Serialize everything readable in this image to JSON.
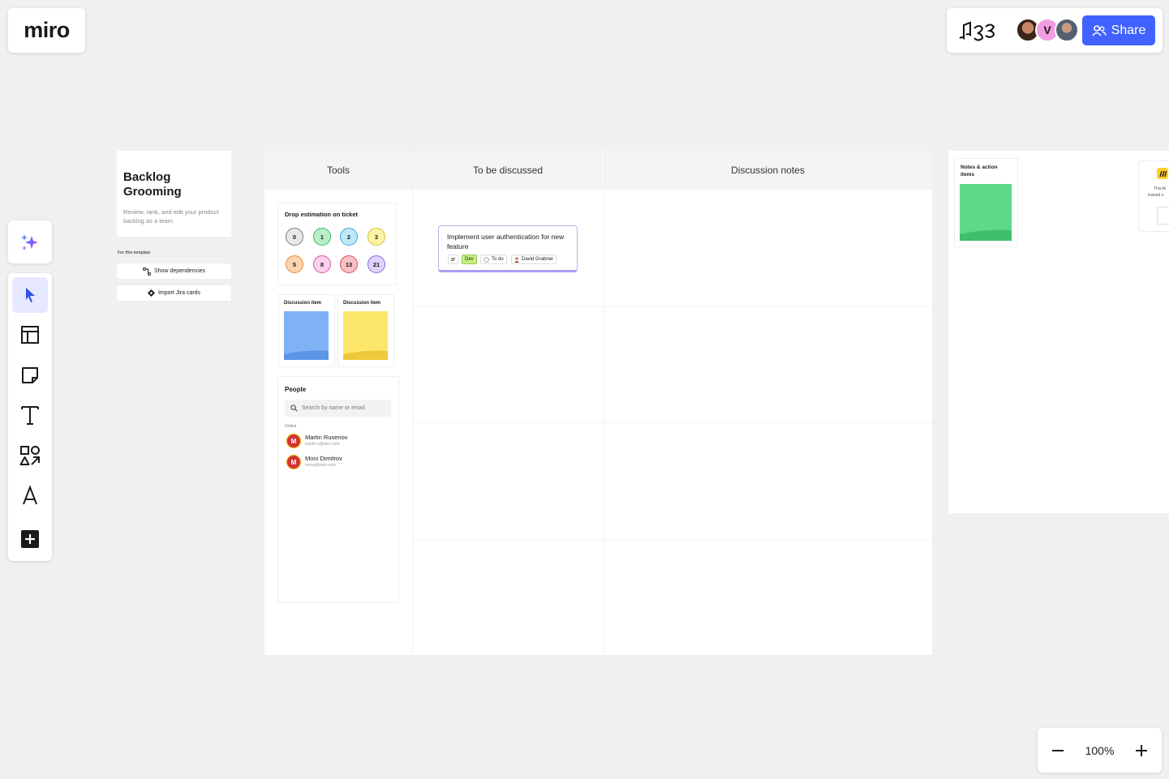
{
  "app": {
    "logo_text": "miro"
  },
  "topbar": {
    "brand_icon": "music-notes-icon",
    "avatars": [
      {
        "name": "avatar-photo-1",
        "label": ""
      },
      {
        "name": "avatar-v",
        "label": "V",
        "color": "#f29ce1"
      },
      {
        "name": "avatar-photo-2",
        "label": ""
      }
    ],
    "share_label": "Share"
  },
  "toolbar": {
    "ai_icon": "sparkles-icon",
    "tools": [
      "select-tool",
      "templates-tool",
      "sticky-note-tool",
      "text-tool",
      "shapes-tool",
      "pen-tool",
      "add-more-tool"
    ]
  },
  "zoom": {
    "level": "100%",
    "minus": "−",
    "plus": "+"
  },
  "intro": {
    "title": "Backlog Grooming",
    "description": "Review, rank, and edit your product backlog as a team.",
    "for_template_label": "For this template",
    "show_dependencies": "Show dependencies",
    "import_jira": "Import Jira cards"
  },
  "board": {
    "columns": [
      "Tools",
      "To be discussed",
      "Discussion notes"
    ]
  },
  "estimation": {
    "title": "Drop estimation on ticket",
    "values": [
      {
        "label": "0",
        "fill": "#e8e8e8",
        "border": "#7a7a7a"
      },
      {
        "label": "1",
        "fill": "#b8efc9",
        "border": "#35b86b"
      },
      {
        "label": "2",
        "fill": "#bfe8f8",
        "border": "#3aa7d8"
      },
      {
        "label": "3",
        "fill": "#fbf3a6",
        "border": "#d8c12e"
      },
      {
        "label": "5",
        "fill": "#fcd3b0",
        "border": "#e88c3c"
      },
      {
        "label": "8",
        "fill": "#fbd0ec",
        "border": "#d256a8"
      },
      {
        "label": "13",
        "fill": "#f7c1c4",
        "border": "#d94b55"
      },
      {
        "label": "21",
        "fill": "#ddd4fb",
        "border": "#8a6ee3"
      }
    ]
  },
  "discussion_items": [
    {
      "title": "Discussion item",
      "color": "#7fb2f5"
    },
    {
      "title": "Discussion item",
      "color": "#fde76a"
    }
  ],
  "people": {
    "title": "People",
    "search_placeholder": "Search by name or email",
    "online_label": "Online",
    "list": [
      {
        "initial": "M",
        "name": "Martin Rusenov",
        "email": "martin.r@miro.com"
      },
      {
        "initial": "M",
        "name": "Moni Dimitrov",
        "email": "mony@miro.com"
      }
    ]
  },
  "ticket": {
    "title": "Implement user authentication for new feature",
    "tag": "Dev",
    "status": "To do",
    "assignee": "David Grabner",
    "tag_color": "#c5f07e"
  },
  "notes": {
    "title": "Notes & action items",
    "sticky_color": "#5fd889"
  },
  "side_card": {
    "text_1": "This AI",
    "text_2": "trained o"
  }
}
